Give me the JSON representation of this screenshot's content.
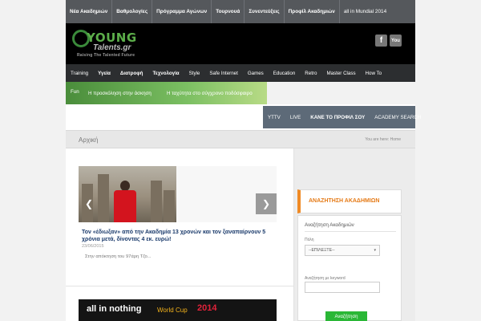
{
  "top_nav": [
    "Νέα Ακαδημιών",
    "Βαθμολογίες",
    "Πρόγραμμα Αγώνων",
    "Τουρνουά",
    "Συνεντεύξεις",
    "Προφίλ Ακαδημιών",
    "all in Mundial 2014"
  ],
  "logo": {
    "young": "YOUNG",
    "talents": "Talents.gr",
    "tagline": "Raising The Talented Future"
  },
  "social": {
    "facebook": "f",
    "youtube": "You"
  },
  "main_nav": [
    "Training",
    "Υγεία",
    "Διατροφή",
    "Τεχνολογία",
    "Style",
    "Safe Internet",
    "Games",
    "Education",
    "Retro",
    "Master Class",
    "How To"
  ],
  "main_nav_bold": [
    false,
    true,
    true,
    true,
    false,
    false,
    false,
    false,
    false,
    false,
    false
  ],
  "sub_nav": {
    "fun": "Fun",
    "link1": "Η προσκόληση στην άσκηση",
    "link2": "Η ταχύτητα στο σύγχρονο ποδόσφαιρο"
  },
  "tabs": [
    "YTTV",
    "LIVE",
    "ΚΑΝΕ ΤΟ ΠΡΟΦΙΛ ΣΟΥ",
    "ACADEMY SEARCH"
  ],
  "breadcrumb": {
    "page_title": "Αρχική",
    "trail": "You are here:  Home"
  },
  "post": {
    "title": "Τον «έδιωξαν» από την Ακαδημία 13 χρονών και τον ξαναπαίρνουν 5 χρόνια μετά, δίνοντας 4 εκ. ευρώ!",
    "date": "23/06/2015",
    "excerpt": "Στην απόκτηση του 97άρη Τζο..."
  },
  "banner": {
    "part1": "all in nothing",
    "part2": "World Cup",
    "part3": "2014"
  },
  "sidebar": {
    "widget_title": "ΑΝΑΖΗΤΗΣΗ ΑΚΑΔΗΜΙΩΝ",
    "heading": "Αναζήτηση Ακαδημιών",
    "city_label": "Πόλη",
    "city_value": "--ΕΠΙΛΕΞΤΕ--",
    "keyword_label": "Αναζήτηση με keyword",
    "submit_label": "Αναζήτηση"
  },
  "colors": {
    "accent_orange": "#e57a16",
    "accent_green": "#2ab736",
    "nav_dark": "#2c2e30"
  }
}
